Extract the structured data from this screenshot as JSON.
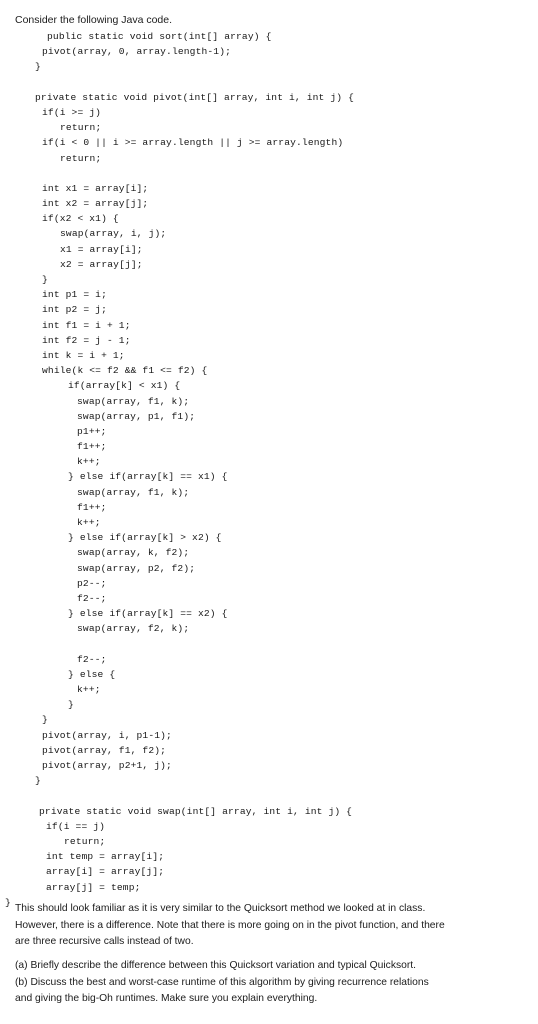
{
  "document": {
    "intro_text": "Consider the following Java code.",
    "code_lines": [
      {
        "indent": 47,
        "text": "public static void sort(int[] array) {"
      },
      {
        "indent": 42,
        "text": "pivot(array, 0, array.length-1);"
      },
      {
        "indent": 35,
        "text": "}"
      },
      {
        "indent": 0,
        "text": ""
      },
      {
        "indent": 35,
        "text": "private static void pivot(int[] array, int i, int j) {"
      },
      {
        "indent": 42,
        "text": "if(i >= j)"
      },
      {
        "indent": 60,
        "text": "return;"
      },
      {
        "indent": 42,
        "text": "if(i < 0 || i >= array.length || j >= array.length)"
      },
      {
        "indent": 60,
        "text": "return;"
      },
      {
        "indent": 0,
        "text": ""
      },
      {
        "indent": 42,
        "text": "int x1 = array[i];"
      },
      {
        "indent": 42,
        "text": "int x2 = array[j];"
      },
      {
        "indent": 42,
        "text": "if(x2 < x1) {"
      },
      {
        "indent": 60,
        "text": "swap(array, i, j);"
      },
      {
        "indent": 60,
        "text": "x1 = array[i];"
      },
      {
        "indent": 60,
        "text": "x2 = array[j];"
      },
      {
        "indent": 42,
        "text": "}"
      },
      {
        "indent": 42,
        "text": "int p1 = i;"
      },
      {
        "indent": 42,
        "text": "int p2 = j;"
      },
      {
        "indent": 42,
        "text": "int f1 = i + 1;"
      },
      {
        "indent": 42,
        "text": "int f2 = j - 1;"
      },
      {
        "indent": 42,
        "text": "int k = i + 1;"
      },
      {
        "indent": 42,
        "text": "while(k <= f2 && f1 <= f2) {"
      },
      {
        "indent": 68,
        "text": "if(array[k] < x1) {"
      },
      {
        "indent": 77,
        "text": "swap(array, f1, k);"
      },
      {
        "indent": 77,
        "text": "swap(array, p1, f1);"
      },
      {
        "indent": 77,
        "text": "p1++;"
      },
      {
        "indent": 77,
        "text": "f1++;"
      },
      {
        "indent": 77,
        "text": "k++;"
      },
      {
        "indent": 68,
        "text": "} else if(array[k] == x1) {"
      },
      {
        "indent": 77,
        "text": "swap(array, f1, k);"
      },
      {
        "indent": 77,
        "text": "f1++;"
      },
      {
        "indent": 77,
        "text": "k++;"
      },
      {
        "indent": 68,
        "text": "} else if(array[k] > x2) {"
      },
      {
        "indent": 77,
        "text": "swap(array, k, f2);"
      },
      {
        "indent": 77,
        "text": "swap(array, p2, f2);"
      },
      {
        "indent": 77,
        "text": "p2--;"
      },
      {
        "indent": 77,
        "text": "f2--;"
      },
      {
        "indent": 68,
        "text": "} else if(array[k] == x2) {"
      },
      {
        "indent": 77,
        "text": "swap(array, f2, k);"
      },
      {
        "indent": 0,
        "text": ""
      },
      {
        "indent": 77,
        "text": "f2--;"
      },
      {
        "indent": 68,
        "text": "} else {"
      },
      {
        "indent": 77,
        "text": "k++;"
      },
      {
        "indent": 68,
        "text": "}"
      },
      {
        "indent": 42,
        "text": "}"
      },
      {
        "indent": 42,
        "text": "pivot(array, i, p1-1);"
      },
      {
        "indent": 42,
        "text": "pivot(array, f1, f2);"
      },
      {
        "indent": 42,
        "text": "pivot(array, p2+1, j);"
      },
      {
        "indent": 35,
        "text": "}"
      },
      {
        "indent": 0,
        "text": ""
      },
      {
        "indent": 39,
        "text": "private static void swap(int[] array, int i, int j) {"
      },
      {
        "indent": 46,
        "text": "if(i == j)"
      },
      {
        "indent": 64,
        "text": "return;"
      },
      {
        "indent": 46,
        "text": "int temp = array[i];"
      },
      {
        "indent": 46,
        "text": "array[i] = array[j];"
      },
      {
        "indent": 46,
        "text": "array[j] = temp;"
      },
      {
        "indent": 5,
        "text": "}"
      }
    ],
    "note_paragraph": "This should look familiar as it is very similar to the Quicksort method we looked at in class. However, there is a difference. Note that there is more going on in the pivot function, and there are three recursive calls instead of two.",
    "question_a": "(a) Briefly describe the difference between this Quicksort variation and typical Quicksort.",
    "question_b": "(b) Discuss the best and worst-case runtime of this algorithm by giving recurrence relations and giving the big-Oh runtimes. Make sure you explain everything."
  }
}
